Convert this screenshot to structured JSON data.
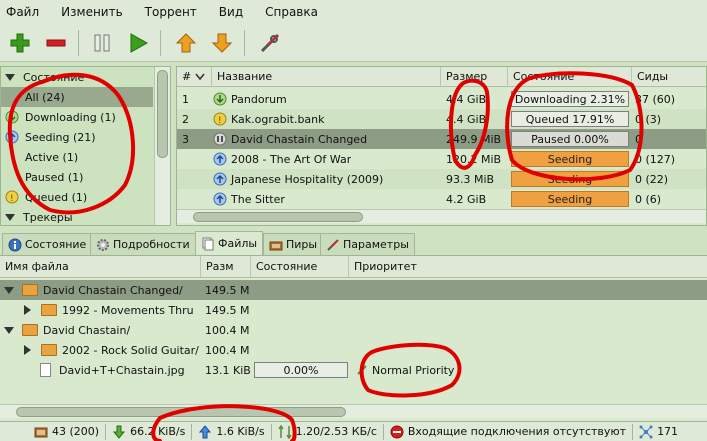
{
  "menu": [
    "Файл",
    "Изменить",
    "Торрент",
    "Вид",
    "Справка"
  ],
  "toolbar": {
    "buttons": [
      "add-icon",
      "remove-icon",
      "pause-icon",
      "resume-icon",
      "queue-up-icon",
      "queue-down-icon",
      "preferences-icon"
    ],
    "colors": {
      "add": "#3a9a1c",
      "remove": "#d02020",
      "resume": "#3aa01a",
      "queue": "#f0a020"
    }
  },
  "sidebar": {
    "state_header": "Состояние",
    "items": [
      {
        "label": "All (24)",
        "icon": "all-icon"
      },
      {
        "label": "Downloading (1)",
        "icon": "download-icon"
      },
      {
        "label": "Seeding (21)",
        "icon": "seed-icon"
      },
      {
        "label": "Active (1)",
        "icon": "active-icon"
      },
      {
        "label": "Paused (1)",
        "icon": "paused-icon"
      },
      {
        "label": "Queued (1)",
        "icon": "queued-icon"
      }
    ],
    "trackers_header": "Трекеры"
  },
  "torrent_list": {
    "headers": {
      "num": "#",
      "name": "Название",
      "size": "Размер",
      "state": "Состояние",
      "seeds": "Сиды"
    },
    "rows": [
      {
        "num": "1",
        "name": "Pandorum",
        "size": "4.4 GiB",
        "state": "Downloading 2.31%",
        "progress": 0.0231,
        "seeds": "37 (60)",
        "kind": "download"
      },
      {
        "num": "2",
        "name": "Kak.ograbit.bank",
        "size": "4.4 GiB",
        "state": "Queued 17.91%",
        "progress": 0.1791,
        "seeds": "0 (3)",
        "kind": "queued"
      },
      {
        "num": "3",
        "name": "David Chastain Changed",
        "size": "249.9 MiB",
        "state": "Paused 0.00%",
        "progress": 0.0,
        "seeds": "0",
        "kind": "paused"
      },
      {
        "num": "",
        "name": "2008 - The Art Of War",
        "size": "120.2 MiB",
        "state": "Seeding",
        "progress": 1.0,
        "seeds": "0 (127)",
        "kind": "seed"
      },
      {
        "num": "",
        "name": "Japanese Hospitality (2009)",
        "size": "93.3 MiB",
        "state": "Seeding",
        "progress": 1.0,
        "seeds": "0 (22)",
        "kind": "seed"
      },
      {
        "num": "",
        "name": "The Sitter",
        "size": "4.2 GiB",
        "state": "Seeding",
        "progress": 1.0,
        "seeds": "0 (6)",
        "kind": "seed"
      }
    ]
  },
  "tabs": [
    "Состояние",
    "Подробности",
    "Файлы",
    "Пиры",
    "Параметры"
  ],
  "files": {
    "headers": {
      "name": "Имя файла",
      "size": "Разм",
      "state": "Состояние",
      "priority": "Приоритет"
    },
    "rows": [
      {
        "name": "David Chastain Changed/",
        "size": "149.5 M",
        "type": "folder",
        "level": 0,
        "expanded": true
      },
      {
        "name": "1992 - Movements Thru",
        "size": "149.5 M",
        "type": "folder",
        "level": 1,
        "expanded": false
      },
      {
        "name": "David Chastain/",
        "size": "100.4 M",
        "type": "folder",
        "level": 0,
        "expanded": true
      },
      {
        "name": "2002 - Rock Solid Guitar/",
        "size": "100.4 M",
        "type": "folder",
        "level": 1,
        "expanded": false
      },
      {
        "name": "David+T+Chastain.jpg",
        "size": "13.1 KiB",
        "type": "file",
        "level": 1,
        "progress": "0.00%",
        "priority": "Normal Priority"
      }
    ]
  },
  "status": {
    "connections": "43 (200)",
    "download": "66.2 KiB/s",
    "upload": "1.6 KiB/s",
    "protocol": "1.20/2.53 КБ/с",
    "incoming": "Входящие подключения отсутствуют",
    "dht": "171"
  },
  "annotation_color": "#e00000"
}
